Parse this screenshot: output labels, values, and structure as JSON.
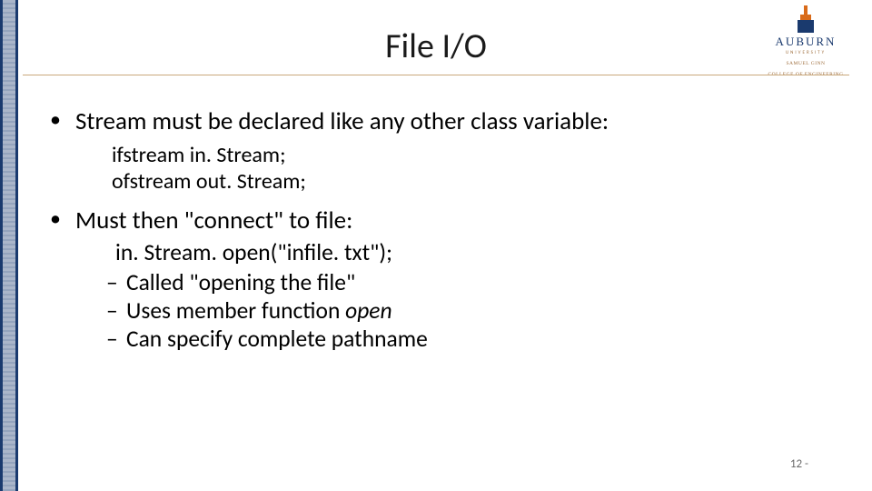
{
  "title": "File I/O",
  "logo": {
    "name": "AUBURN",
    "sub1": "UNIVERSITY",
    "sub2": "SAMUEL GINN",
    "sub3": "COLLEGE OF ENGINEERING"
  },
  "bullets": {
    "b1": "Stream must be declared like any other class variable:",
    "code1a": "ifstream in. Stream;",
    "code1b": "ofstream out. Stream;",
    "b2": "Must then \"connect\" to file:",
    "code2": "in. Stream. open(\"infile. txt\");",
    "d1": "Called \"opening the file\"",
    "d2a": "Uses member function ",
    "d2b": "open",
    "d3": "Can specify complete pathname"
  },
  "page": "12 -"
}
